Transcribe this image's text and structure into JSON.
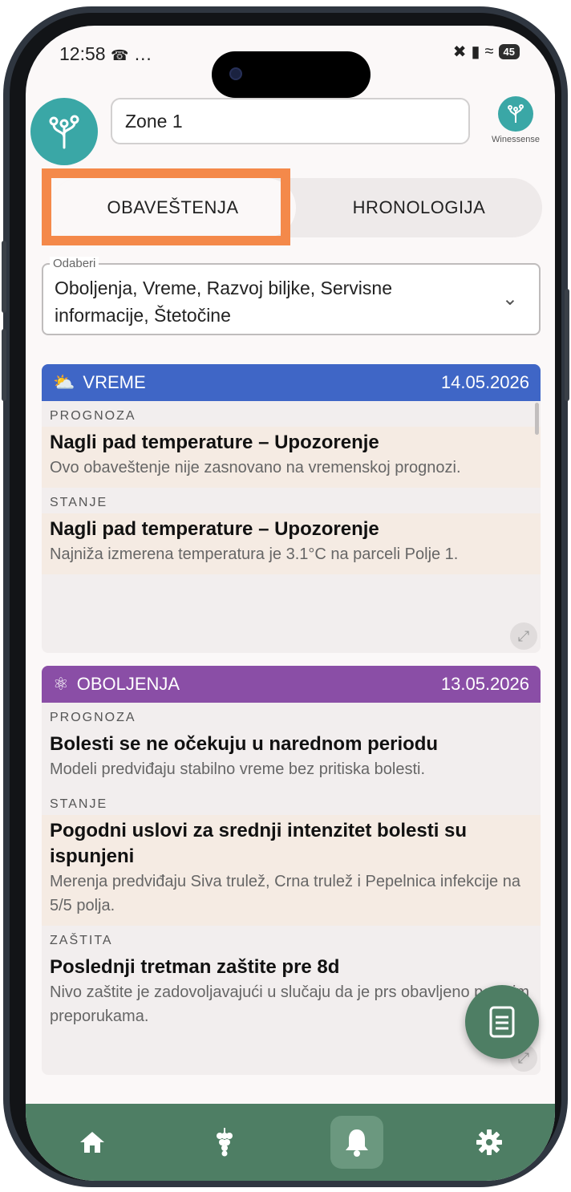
{
  "status_bar": {
    "time": "12:58",
    "extras": "…",
    "battery": "45"
  },
  "header": {
    "zone_value": "Zone 1",
    "brand_name": "Winessense"
  },
  "tabs": [
    {
      "label": "OBAVEŠTENJA",
      "active": true
    },
    {
      "label": "HRONOLOGIJA",
      "active": false
    }
  ],
  "filter": {
    "label": "Odaberi",
    "value": "Oboljenja, Vreme, Razvoj biljke, Servisne informacije, Štetočine"
  },
  "cards": [
    {
      "category": "VREME",
      "date": "14.05.2026",
      "color": "#3f66c6",
      "icon": "weather-icon",
      "sections": [
        {
          "label": "PROGNOZA",
          "title": "Nagli pad temperature – Upozorenje",
          "text": "Ovo obaveštenje nije zasnovano na vremenskoj prognozi."
        },
        {
          "label": "STANJE",
          "title": "Nagli pad temperature – Upozorenje",
          "text": "Najniža izmerena temperatura je 3.1°C na parceli Polje 1."
        }
      ]
    },
    {
      "category": "OBOLJENJA",
      "date": "13.05.2026",
      "color": "#8a4ea6",
      "icon": "disease-icon",
      "sections": [
        {
          "label": "PROGNOZA",
          "title": "Bolesti se ne očekuju u narednom periodu",
          "text": "Modeli predviđaju stabilno vreme bez pritiska bolesti."
        },
        {
          "label": "STANJE",
          "title": "Pogodni uslovi za srednji intenzitet bolesti su ispunjeni",
          "text": "Merenja predviđaju Siva trulež, Crna trulež i Pepelnica infekcije na 5/5 polja."
        },
        {
          "label": "ZAŠTITA",
          "title": "Poslednji tretman zaštite pre 8d",
          "text": "Nivo zaštite je zadovoljavajući u slučaju da je prs obavljeno po svim preporukama."
        }
      ]
    }
  ],
  "bottom_nav": [
    {
      "icon": "home-icon",
      "active": false
    },
    {
      "icon": "grape-icon",
      "active": false
    },
    {
      "icon": "bell-icon",
      "active": true
    },
    {
      "icon": "gear-icon",
      "active": false
    }
  ],
  "colors": {
    "nav_green": "#4e7e64",
    "highlight_orange": "#f4894a",
    "logo_teal": "#3aa7a6"
  }
}
